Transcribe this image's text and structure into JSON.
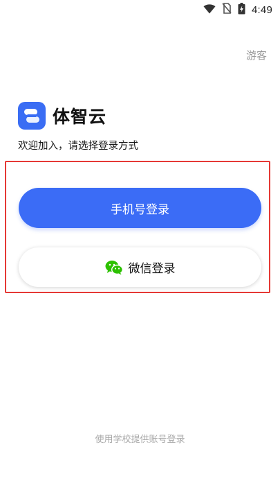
{
  "status_bar": {
    "time": "4:49",
    "icons": [
      "wifi-icon",
      "no-sim-icon",
      "battery-charging-icon"
    ]
  },
  "header": {
    "guest_label": "游客"
  },
  "brand": {
    "logo_icon": "app-logo-icon",
    "app_name": "体智云",
    "welcome_text": "欢迎加入，请选择登录方式"
  },
  "login": {
    "phone_button_label": "手机号登录",
    "wechat_button_label": "微信登录",
    "wechat_icon": "wechat-icon"
  },
  "footer": {
    "school_account_link": "使用学校提供账号登录"
  },
  "colors": {
    "primary": "#3b6cf6",
    "highlight_border": "#e53935",
    "wechat_green": "#2dc100",
    "muted_text": "#9a9a9a"
  }
}
